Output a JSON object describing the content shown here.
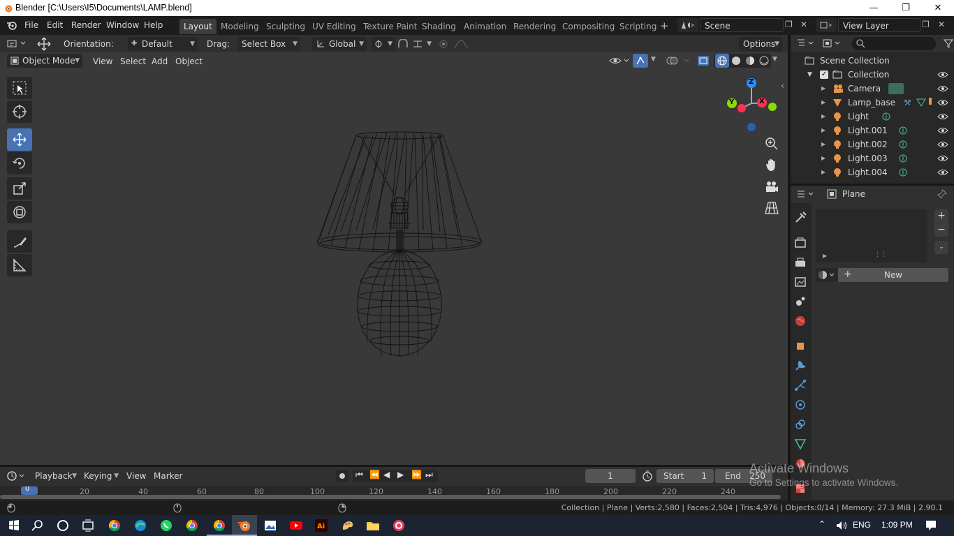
{
  "window": {
    "title": "Blender [C:\\Users\\I5\\Documents\\LAMP.blend]"
  },
  "menus": [
    "File",
    "Edit",
    "Render",
    "Window",
    "Help"
  ],
  "workspaces": [
    "Layout",
    "Modeling",
    "Sculpting",
    "UV Editing",
    "Texture Paint",
    "Shading",
    "Animation",
    "Rendering",
    "Compositing",
    "Scripting"
  ],
  "scene": {
    "name": "Scene",
    "view_layer": "View Layer"
  },
  "tool_header": {
    "orientation_label": "Orientation:",
    "orientation_value": "Default",
    "drag_label": "Drag:",
    "drag_value": "Select Box",
    "transform": "Global",
    "options": "Options"
  },
  "viewport_header": {
    "mode": "Object Mode",
    "menus": [
      "View",
      "Select",
      "Add",
      "Object"
    ]
  },
  "gizmo": {
    "z": "Z",
    "x": "X",
    "y": "Y"
  },
  "outliner": {
    "root": "Scene Collection",
    "collection": "Collection",
    "items": [
      "Camera",
      "Lamp_base",
      "Light",
      "Light.001",
      "Light.002",
      "Light.003",
      "Light.004"
    ]
  },
  "properties": {
    "object": "Plane",
    "new_button": "New"
  },
  "timeline": {
    "menus": [
      "Playback",
      "Keying",
      "View",
      "Marker"
    ],
    "current_frame": "1",
    "start_label": "Start",
    "start": "1",
    "end_label": "End",
    "end": "250",
    "ruler": [
      "0",
      "20",
      "40",
      "60",
      "80",
      "100",
      "120",
      "140",
      "160",
      "180",
      "200",
      "220",
      "240"
    ]
  },
  "status": {
    "text": "Collection | Plane | Verts:2,580 | Faces:2,504 | Tris:4,976 | Objects:0/14 | Memory: 27.3 MiB | 2.90.1"
  },
  "watermark": {
    "line1": "Activate Windows",
    "line2": "Go to Settings to activate Windows."
  },
  "taskbar": {
    "lang": "ENG",
    "time": "1:09 PM"
  },
  "colors": {
    "accent": "#4772b3",
    "axis_x": "#ff3352",
    "axis_y": "#8bdc00",
    "axis_z": "#2890ff",
    "active_ws": "#3d3d3d"
  }
}
